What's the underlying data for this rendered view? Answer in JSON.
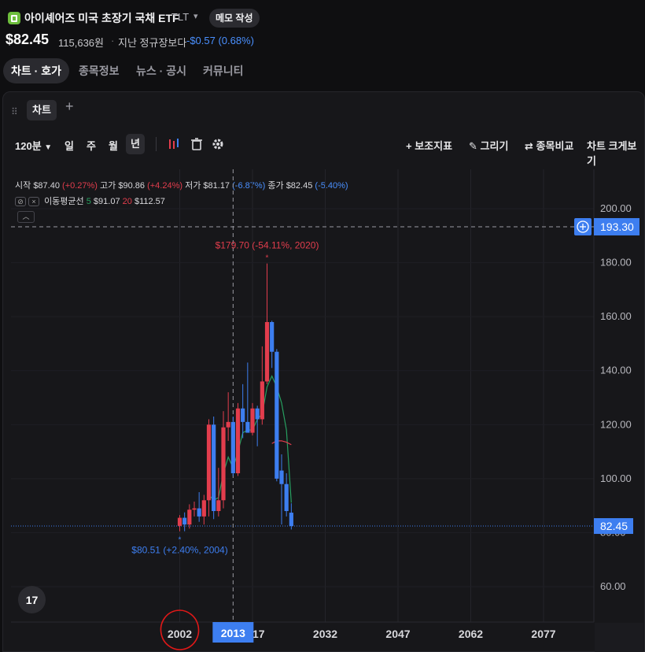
{
  "header": {
    "title": "아이셰어즈 미국 초장기 국채 ETF",
    "ticker": "TLT",
    "memo_button": "메모 작성",
    "price": "$82.45",
    "price_won": "115,636원",
    "compare_label": "지난 정규장보다",
    "change": "-$0.57 (0.68%)"
  },
  "tabs": [
    {
      "label": "차트 · 호가",
      "active": true
    },
    {
      "label": "종목정보",
      "active": false
    },
    {
      "label": "뉴스 · 공시",
      "active": false
    },
    {
      "label": "커뮤니티",
      "active": false
    }
  ],
  "chart_tab": {
    "label": "차트",
    "add_icon": "plus-icon"
  },
  "toolbar": {
    "interval": "120분",
    "periods": [
      "일",
      "주",
      "월",
      "년"
    ],
    "selected_period": "년",
    "indicators": "보조지표",
    "draw": "그리기",
    "compare": "종목비교",
    "enlarge": "차트 크게보기"
  },
  "legend": {
    "open_label": "시작",
    "open": "$87.40",
    "open_chg": "(+0.27%)",
    "high_label": "고가",
    "high": "$90.86",
    "high_chg": "(+4.24%)",
    "low_label": "저가",
    "low": "$81.17",
    "low_chg": "(-6.87%)",
    "close_label": "종가",
    "close": "$82.45",
    "close_chg": "(-5.40%)",
    "ma_label": "이동평균선",
    "ma_short_period": "5",
    "ma_short_value": "$91.07",
    "ma_long_period": "20",
    "ma_long_value": "$112.57"
  },
  "annotations": {
    "max_label": "$179.70 (-54.11%, 2020)",
    "min_label": "$80.51 (+2.40%, 2004)",
    "crosshair_price": "193.30",
    "last_price": "82.45",
    "crosshair_year": "2013"
  },
  "colors": {
    "up": "#e23d4d",
    "down": "#3d7ef0",
    "ma5": "#27a060",
    "ma20": "#e23d4d",
    "accent": "#3d7ef0"
  },
  "chart_data": {
    "type": "candlestick",
    "interval": "year",
    "y_ticks": [
      "200.00",
      "180.00",
      "160.00",
      "140.00",
      "120.00",
      "100.00",
      "80.00",
      "60.00"
    ],
    "x_ticks": [
      "2002",
      "2017",
      "2032",
      "2047",
      "2062",
      "2077"
    ],
    "ylim": [
      48,
      214
    ],
    "candles": [
      {
        "year": 2002,
        "open": 82.5,
        "high": 86.5,
        "low": 80.5,
        "close": 85.5
      },
      {
        "year": 2003,
        "open": 85.5,
        "high": 87.5,
        "low": 80.51,
        "close": 83.0
      },
      {
        "year": 2004,
        "open": 83.0,
        "high": 90.5,
        "low": 81.5,
        "close": 88.5
      },
      {
        "year": 2005,
        "open": 88.5,
        "high": 91.5,
        "low": 86.0,
        "close": 89.0
      },
      {
        "year": 2006,
        "open": 89.0,
        "high": 95.0,
        "low": 84.0,
        "close": 86.0
      },
      {
        "year": 2007,
        "open": 86.0,
        "high": 94.0,
        "low": 83.0,
        "close": 92.0
      },
      {
        "year": 2008,
        "open": 92.0,
        "high": 122.0,
        "low": 86.0,
        "close": 120.0
      },
      {
        "year": 2009,
        "open": 120.0,
        "high": 123.0,
        "low": 85.0,
        "close": 88.0
      },
      {
        "year": 2010,
        "open": 88.0,
        "high": 104.0,
        "low": 86.0,
        "close": 92.0
      },
      {
        "year": 2011,
        "open": 92.0,
        "high": 125.0,
        "low": 89.0,
        "close": 119.0
      },
      {
        "year": 2012,
        "open": 119.0,
        "high": 132.0,
        "low": 114.0,
        "close": 121.0
      },
      {
        "year": 2013,
        "open": 121.0,
        "high": 123.0,
        "low": 101.0,
        "close": 102.0
      },
      {
        "year": 2014,
        "open": 102.0,
        "high": 128.0,
        "low": 101.0,
        "close": 126.0
      },
      {
        "year": 2015,
        "open": 126.0,
        "high": 135.0,
        "low": 115.0,
        "close": 121.0
      },
      {
        "year": 2016,
        "open": 121.0,
        "high": 143.0,
        "low": 118.0,
        "close": 117.0
      },
      {
        "year": 2017,
        "open": 117.0,
        "high": 128.0,
        "low": 116.0,
        "close": 126.0
      },
      {
        "year": 2018,
        "open": 126.0,
        "high": 127.0,
        "low": 112.0,
        "close": 122.0
      },
      {
        "year": 2019,
        "open": 122.0,
        "high": 149.0,
        "low": 120.0,
        "close": 136.0
      },
      {
        "year": 2020,
        "open": 136.0,
        "high": 179.7,
        "low": 135.0,
        "close": 158.0
      },
      {
        "year": 2021,
        "open": 158.0,
        "high": 158.5,
        "low": 141.0,
        "close": 147.0
      },
      {
        "year": 2022,
        "open": 147.0,
        "high": 148.0,
        "low": 99.0,
        "close": 100.0
      },
      {
        "year": 2023,
        "open": 103.0,
        "high": 109.0,
        "low": 83.0,
        "close": 98.0
      },
      {
        "year": 2024,
        "open": 98.0,
        "high": 102.0,
        "low": 86.0,
        "close": 88.0
      },
      {
        "year": 2025,
        "open": 87.4,
        "high": 90.86,
        "low": 81.17,
        "close": 82.45
      }
    ],
    "ma5": [
      {
        "year": 2008,
        "value": 94.0
      },
      {
        "year": 2009,
        "value": 92.0
      },
      {
        "year": 2010,
        "value": 93.0
      },
      {
        "year": 2011,
        "value": 102.0
      },
      {
        "year": 2012,
        "value": 108.0
      },
      {
        "year": 2013,
        "value": 104.0
      },
      {
        "year": 2014,
        "value": 110.0
      },
      {
        "year": 2015,
        "value": 117.0
      },
      {
        "year": 2016,
        "value": 118.0
      },
      {
        "year": 2017,
        "value": 118.0
      },
      {
        "year": 2018,
        "value": 122.0
      },
      {
        "year": 2019,
        "value": 124.0
      },
      {
        "year": 2020,
        "value": 134.0
      },
      {
        "year": 2021,
        "value": 138.0
      },
      {
        "year": 2022,
        "value": 134.0
      },
      {
        "year": 2023,
        "value": 128.0
      },
      {
        "year": 2024,
        "value": 118.0
      },
      {
        "year": 2025,
        "value": 91.07
      }
    ],
    "ma20": [
      {
        "year": 2021,
        "value": 113.0
      },
      {
        "year": 2022,
        "value": 114.0
      },
      {
        "year": 2023,
        "value": 114.0
      },
      {
        "year": 2024,
        "value": 113.5
      },
      {
        "year": 2025,
        "value": 112.57
      }
    ]
  }
}
